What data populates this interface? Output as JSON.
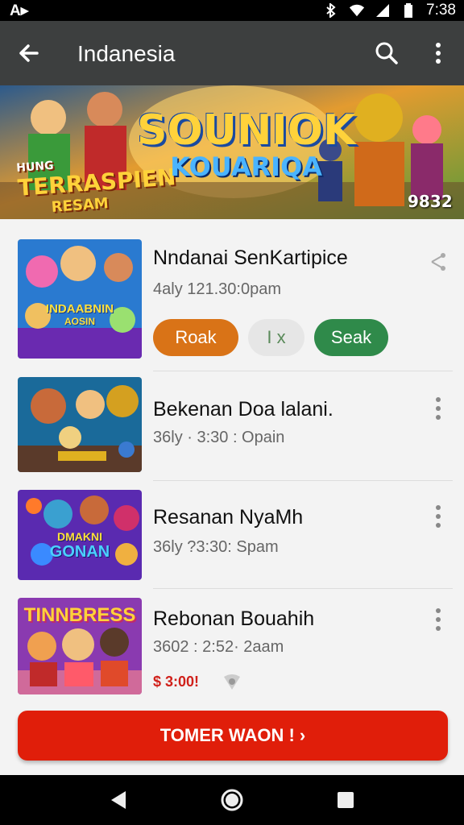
{
  "status_bar": {
    "left_text": "A▸",
    "time": "7:38",
    "icons": [
      "notification-icon",
      "bluetooth-icon",
      "wifi-icon",
      "signal-icon",
      "battery-icon"
    ]
  },
  "app_bar": {
    "title": "Indanesia",
    "icons": [
      "back-arrow-icon",
      "search-icon",
      "more-vert-icon"
    ]
  },
  "banner": {
    "left_text_line1": "HUNG",
    "left_text_line2": "TERRASPIEN",
    "left_text_line3": "RESAM",
    "center_text_line1": "SOUNIOK",
    "center_text_line2": "KOUARIQA",
    "right_badge": "9832"
  },
  "list": {
    "items": [
      {
        "title": "Nndanai SenKartipice",
        "subtitle": "4aly 121.30:0pam",
        "thumb_text_line1": "INDAABNIN",
        "thumb_text_line2": "AOSIN",
        "chips": [
          {
            "label": "Roak",
            "color": "#d97317"
          },
          {
            "label": "I x",
            "color": "#e6e6e6"
          },
          {
            "label": "Seak",
            "color": "#2f8a4a"
          }
        ]
      },
      {
        "title": "Bekenan Doa lalani.",
        "subtitle": "36ly · 3:30 : Opain",
        "thumb_text_line1": "",
        "thumb_text_line2": ""
      },
      {
        "title": "Resanan NyaMh",
        "subtitle": "36ly ?3:30: Spam",
        "thumb_text_line1": "DMAKNI",
        "thumb_text_line2": "GONAN"
      },
      {
        "title": "Rebonan Bouahih",
        "subtitle": "3602 : 2:52· 2aam",
        "thumb_text_line1": "TINNBRESS",
        "thumb_text_line2": "",
        "extra_red": "$ 3:00!"
      }
    ]
  },
  "cta": {
    "label": "TOMER WAON ! ›"
  },
  "colors": {
    "app_bar": "#3d3f3f",
    "cta": "#e01e0a",
    "background": "#f3f3f3"
  }
}
